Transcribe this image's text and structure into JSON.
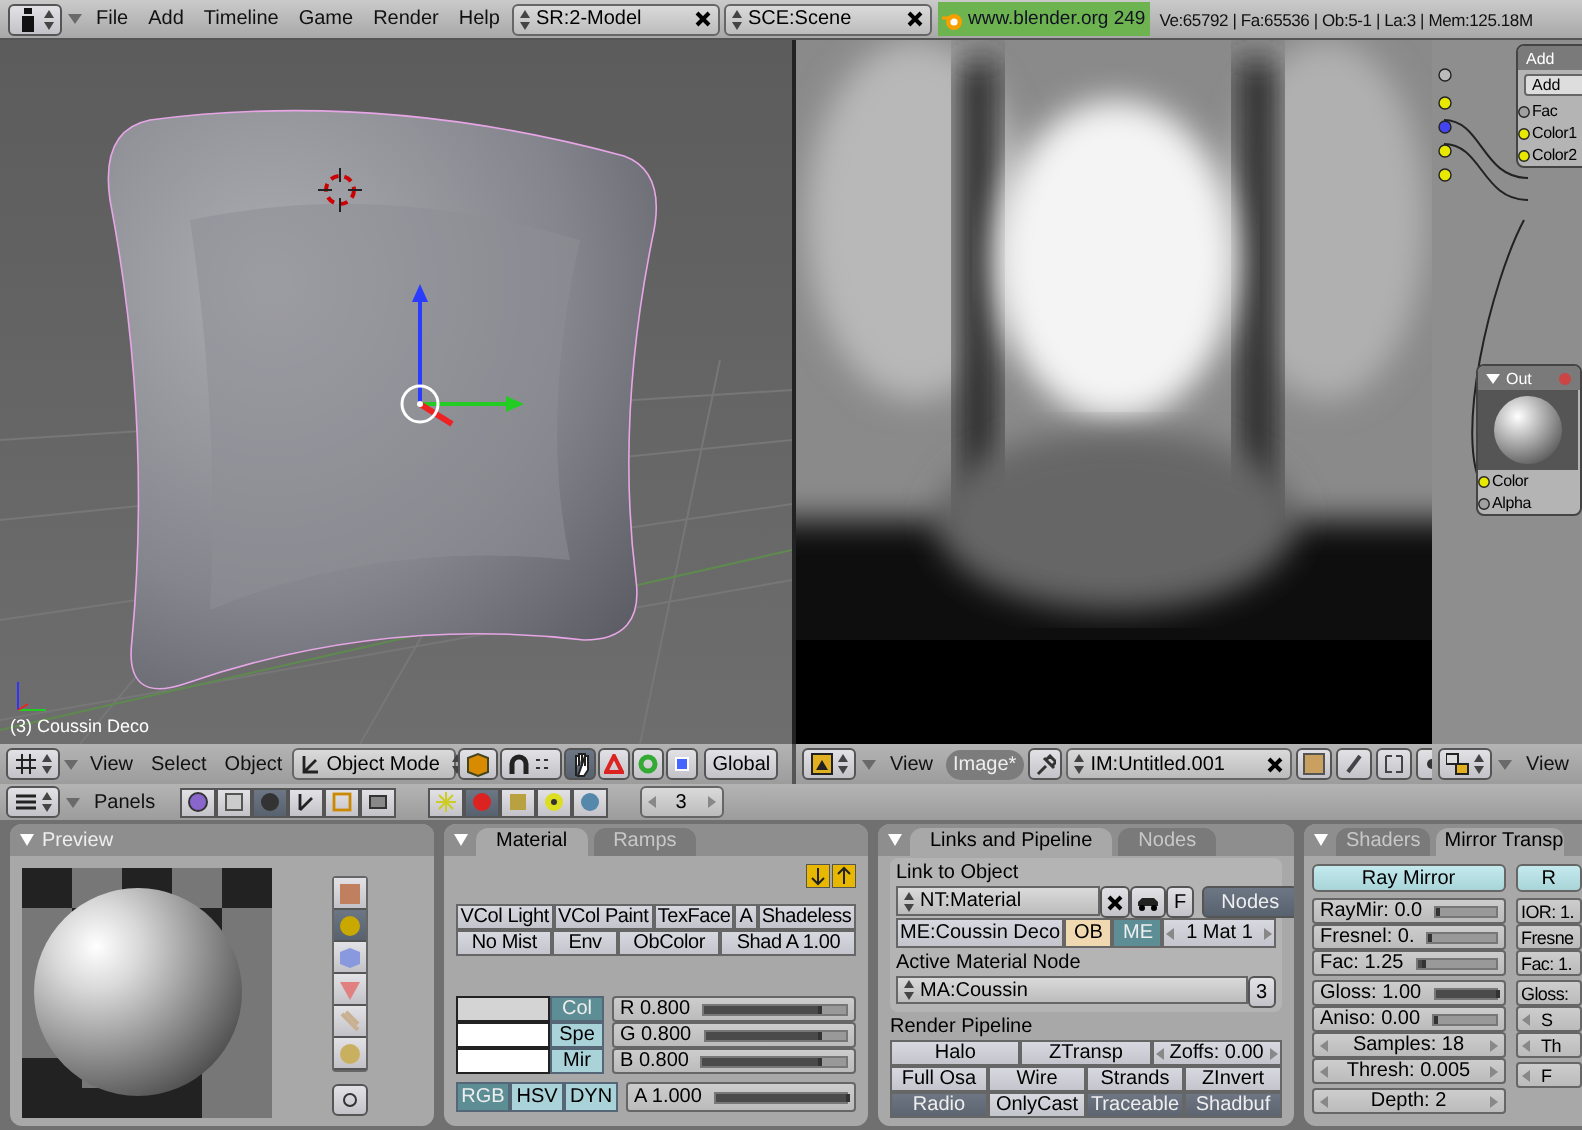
{
  "top_bar": {
    "menus": [
      "File",
      "Add",
      "Timeline",
      "Game",
      "Render",
      "Help"
    ],
    "screen": "SR:2-Model",
    "scene": "SCE:Scene",
    "version": "www.blender.org 249",
    "stats": "Ve:65792 | Fa:65536 | Ob:5-1 | La:3 | Mem:125.18M"
  },
  "viewport_3d": {
    "object_label": "(3) Coussin Deco"
  },
  "node_editor": {
    "nodes": [
      {
        "title": "Add",
        "dropdown": "Add",
        "sockets": [
          {
            "label": "Fac",
            "color": "#a0a0a0"
          },
          {
            "label": "Color1",
            "color": "#e8e800"
          },
          {
            "label": "Color2",
            "color": "#e8e800"
          }
        ]
      },
      {
        "title": "Out",
        "sockets": [
          {
            "label": "Color",
            "color": "#e8e800"
          },
          {
            "label": "Alpha",
            "color": "#a0a0a0"
          }
        ]
      }
    ]
  },
  "view3d_header": {
    "menus": [
      "View",
      "Select",
      "Object"
    ],
    "mode": "Object Mode",
    "orientation": "Global"
  },
  "image_header": {
    "menus": [
      {
        "label": "View",
        "selected": false
      },
      {
        "label": "Image*",
        "selected": true
      }
    ],
    "image": "IM:Untitled.001"
  },
  "node_header": {
    "menus": [
      "View"
    ]
  },
  "buttons_header": {
    "label": "Panels",
    "contexts": [
      {
        "selected": false
      },
      {
        "selected": false
      },
      {
        "selected": true
      },
      {
        "selected": false
      },
      {
        "selected": false
      },
      {
        "selected": false
      }
    ],
    "subcontexts": [
      {
        "selected": false
      },
      {
        "selected": true
      },
      {
        "selected": false
      },
      {
        "selected": false
      },
      {
        "selected": false
      }
    ],
    "frame": "3"
  },
  "preview": {
    "title": "Preview",
    "types": [
      {
        "selected": false
      },
      {
        "selected": true
      },
      {
        "selected": false
      },
      {
        "selected": false
      },
      {
        "selected": false
      },
      {
        "selected": false
      }
    ]
  },
  "material": {
    "tabs": [
      {
        "label": "Material",
        "selected": true
      },
      {
        "label": "Ramps",
        "selected": false
      }
    ],
    "toggles": [
      [
        {
          "label": "VCol Light",
          "on": false
        },
        {
          "label": "VCol Paint",
          "on": false
        },
        {
          "label": "TexFace",
          "on": false
        },
        {
          "label": "A",
          "on": false
        },
        {
          "label": "Shadeless",
          "on": false
        }
      ],
      [
        {
          "label": "No Mist",
          "on": false
        },
        {
          "label": "Env",
          "on": false
        },
        {
          "label": "ObColor",
          "on": false
        },
        {
          "label": "Shad A 1.00",
          "on": false
        }
      ]
    ],
    "swatches": [
      {
        "label": "Col",
        "color": "#d4d4d4",
        "selected": true
      },
      {
        "label": "Spe",
        "color": "#ffffff",
        "selected": false
      },
      {
        "label": "Mir",
        "color": "#ffffff",
        "selected": false
      }
    ],
    "sliders": [
      {
        "label": "R 0.800",
        "level": 0.8
      },
      {
        "label": "G 0.800",
        "level": 0.8
      },
      {
        "label": "B 0.800",
        "level": 0.8
      }
    ],
    "color_models": [
      {
        "label": "RGB",
        "selected": true
      },
      {
        "label": "HSV",
        "selected": false
      },
      {
        "label": "DYN",
        "selected": false
      }
    ],
    "alpha": {
      "label": "A 1.000",
      "level": 1
    }
  },
  "links": {
    "tabs": [
      {
        "label": "Links and Pipeline",
        "selected": true
      },
      {
        "label": "Nodes",
        "selected": false
      }
    ],
    "link_label": "Link to Object",
    "node_tree": "NT:Material",
    "fake_user": "F",
    "nodes_button": {
      "label": "Nodes",
      "on": true
    },
    "mesh": "ME:Coussin Deco",
    "link_modes": [
      {
        "label": "OB",
        "selected": false
      },
      {
        "label": "ME",
        "selected": true
      }
    ],
    "material_index": "1 Mat 1",
    "active_label": "Active Material Node",
    "active_material": "MA:Coussin",
    "users": "3",
    "pipeline_label": "Render Pipeline",
    "pipeline": [
      [
        {
          "label": "Halo",
          "kind": "toggle",
          "on": false
        },
        {
          "label": "ZTransp",
          "kind": "toggle",
          "on": false
        },
        {
          "label": "Zoffs: 0.00",
          "kind": "number"
        }
      ],
      [
        {
          "label": "Full Osa",
          "kind": "toggle",
          "on": false
        },
        {
          "label": "Wire",
          "kind": "toggle",
          "on": false
        },
        {
          "label": "Strands",
          "kind": "toggle",
          "on": false
        },
        {
          "label": "ZInvert",
          "kind": "toggle",
          "on": false
        }
      ],
      [
        {
          "label": "Radio",
          "kind": "toggle",
          "on": true
        },
        {
          "label": "OnlyCast",
          "kind": "toggle",
          "on": false
        },
        {
          "label": "Traceable",
          "kind": "toggle",
          "on": true
        },
        {
          "label": "Shadbuf",
          "kind": "toggle",
          "on": true
        }
      ]
    ]
  },
  "shaders": {
    "tabs": [
      {
        "label": "Shaders",
        "selected": false
      },
      {
        "label": "Mirror Transp",
        "selected": true
      }
    ],
    "columns": [
      {
        "button": "Ray Mirror",
        "groups": [
          [
            {
              "kind": "slider",
              "label": "RayMir: 0.0",
              "level": 0
            },
            {
              "kind": "slider",
              "label": "Fresnel: 0.",
              "level": 0
            },
            {
              "kind": "slider",
              "label": "Fac: 1.25",
              "level": 0.05
            }
          ],
          [
            {
              "kind": "slider",
              "label": "Gloss: 1.00",
              "level": 1
            },
            {
              "kind": "slider",
              "label": "Aniso: 0.00",
              "level": 0
            },
            {
              "kind": "number",
              "label": "Samples: 18"
            },
            {
              "kind": "number",
              "label": "Thresh: 0.005"
            }
          ],
          [
            {
              "kind": "number",
              "label": "Depth: 2"
            }
          ]
        ]
      },
      {
        "button": "R",
        "groups": [
          [
            {
              "kind": "slider",
              "label": "IOR: 1."
            },
            {
              "kind": "slider",
              "label": "Fresne"
            },
            {
              "kind": "slider",
              "label": "Fac: 1."
            }
          ],
          [
            {
              "kind": "slider",
              "label": "Gloss:"
            },
            {
              "kind": "number",
              "label": "S"
            },
            {
              "kind": "number",
              "label": "Th"
            }
          ],
          [
            {
              "kind": "number",
              "label": "F"
            }
          ]
        ]
      }
    ]
  }
}
